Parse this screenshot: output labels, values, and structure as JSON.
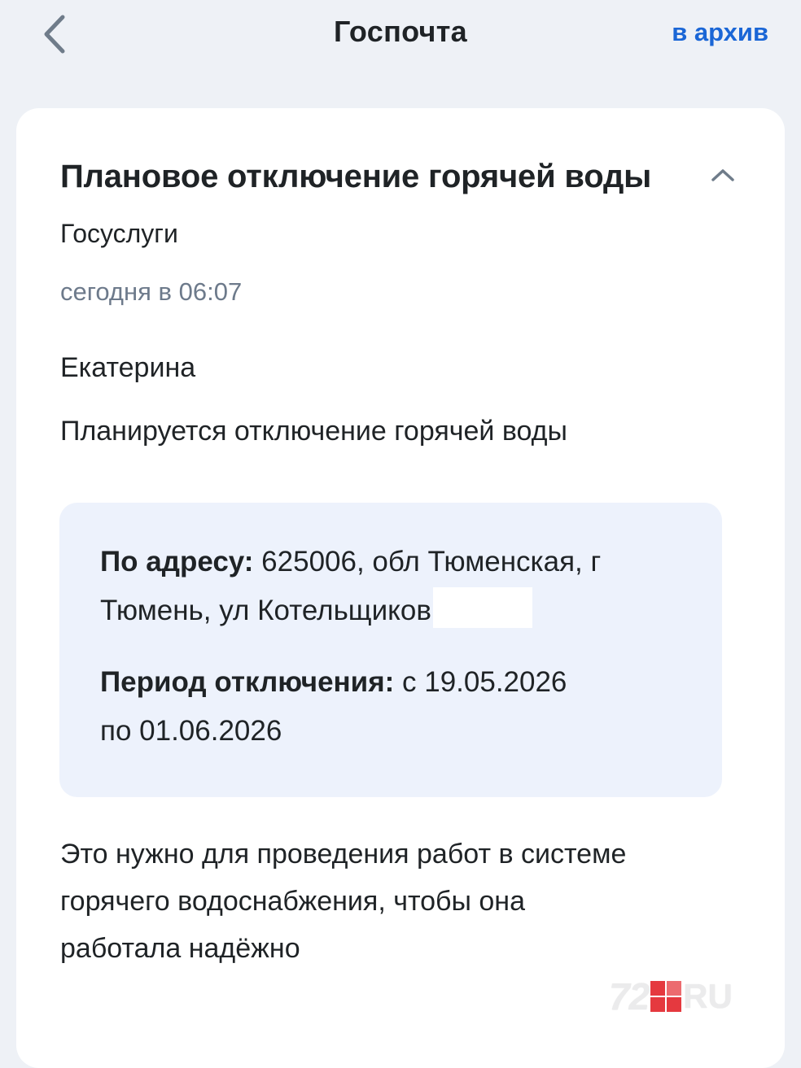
{
  "header": {
    "title": "Госпочта",
    "archive_label": "в архив",
    "back_icon": "chevron-left-icon"
  },
  "message": {
    "subject": "Плановое отключение горячей воды",
    "sender": "Госуслуги",
    "time": "сегодня в 06:07",
    "greeting": "Екатерина",
    "lead": "Планируется отключение горячей воды",
    "details": {
      "address_label": "По адресу:",
      "address_line1": " 625006, обл Тюменская, г",
      "address_line2": "Тюмень, ул Котельщиков",
      "period_label": "Период отключения:",
      "period_line1": " с 19.05.2026",
      "period_line2": "по 01.06.2026"
    },
    "footer_line1": "Это нужно для проведения работ в системе",
    "footer_line2": "горячего водоснабжения, чтобы она",
    "footer_line3": "работала надёжно"
  },
  "watermark": {
    "left": "72",
    "right": "RU",
    "accent_color": "#e3242b"
  },
  "colors": {
    "accent": "#1a66d6",
    "background": "#eef1f6",
    "info_box": "#edf2fc",
    "muted_text": "#6d7a8b"
  }
}
